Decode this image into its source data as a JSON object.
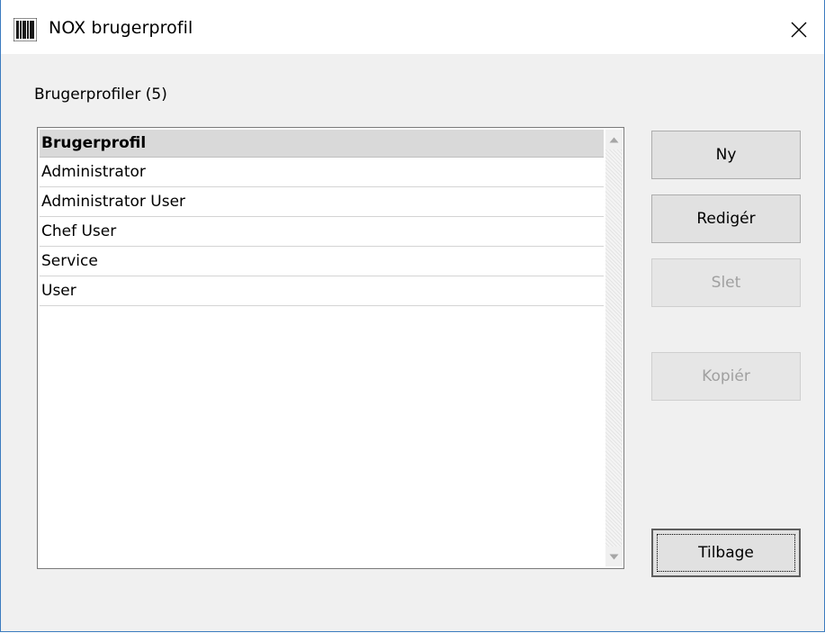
{
  "window": {
    "title": "NOX brugerprofil",
    "icon": "barcode-app-icon",
    "close_icon": "close-icon"
  },
  "profiles": {
    "count_label": "Brugerprofiler (5)",
    "column_header": "Brugerprofil",
    "items": [
      "Administrator",
      "Administrator User",
      "Chef User",
      "Service",
      "User"
    ]
  },
  "buttons": {
    "new": "Ny",
    "edit": "Redigér",
    "delete": "Slet",
    "copy": "Kopiér",
    "back": "Tilbage"
  },
  "colors": {
    "window_border": "#3b7bbf",
    "client_background": "#f0f0f0",
    "header_background": "#d9d9d9",
    "disabled_text": "#a0a0a0"
  }
}
